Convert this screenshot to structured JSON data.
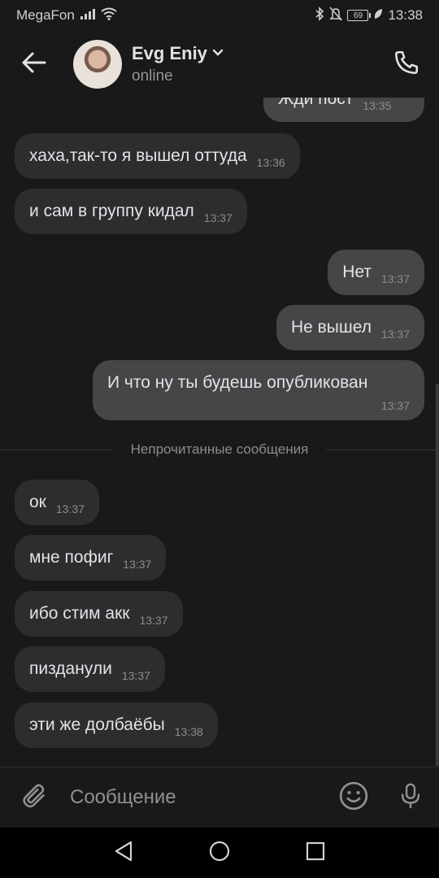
{
  "status_bar": {
    "carrier": "MegaFon",
    "battery": "69",
    "time": "13:38"
  },
  "header": {
    "name": "Evg Eniy",
    "status": "online",
    "icons": {
      "back": "arrow-left-icon",
      "dropdown": "chevron-down-icon",
      "call": "phone-icon"
    }
  },
  "messages": [
    {
      "text": "Жди пост",
      "time": "13:35",
      "direction": "out"
    },
    {
      "text": "хаха,так-то я вышел оттуда",
      "time": "13:36",
      "direction": "in"
    },
    {
      "text": "и сам в группу кидал",
      "time": "13:37",
      "direction": "in"
    },
    {
      "text": "Нет",
      "time": "13:37",
      "direction": "out"
    },
    {
      "text": "Не вышел",
      "time": "13:37",
      "direction": "out"
    },
    {
      "text": "И что ну ты будешь опубликован",
      "time": "13:37",
      "direction": "out"
    },
    {
      "text": "ок",
      "time": "13:37",
      "direction": "in"
    },
    {
      "text": "мне пофиг",
      "time": "13:37",
      "direction": "in"
    },
    {
      "text": "ибо стим акк",
      "time": "13:37",
      "direction": "in"
    },
    {
      "text": "пизданули",
      "time": "13:37",
      "direction": "in"
    },
    {
      "text": "эти же долбаёбы",
      "time": "13:38",
      "direction": "in"
    }
  ],
  "unread_divider": "Непрочитанные сообщения",
  "composer": {
    "placeholder": "Сообщение",
    "value": ""
  },
  "colors": {
    "background": "#19191a",
    "incoming_bubble": "#2c2d2e",
    "outgoing_bubble": "#454647",
    "text": "#e1e3e6",
    "secondary_text": "#8a8c8f"
  }
}
